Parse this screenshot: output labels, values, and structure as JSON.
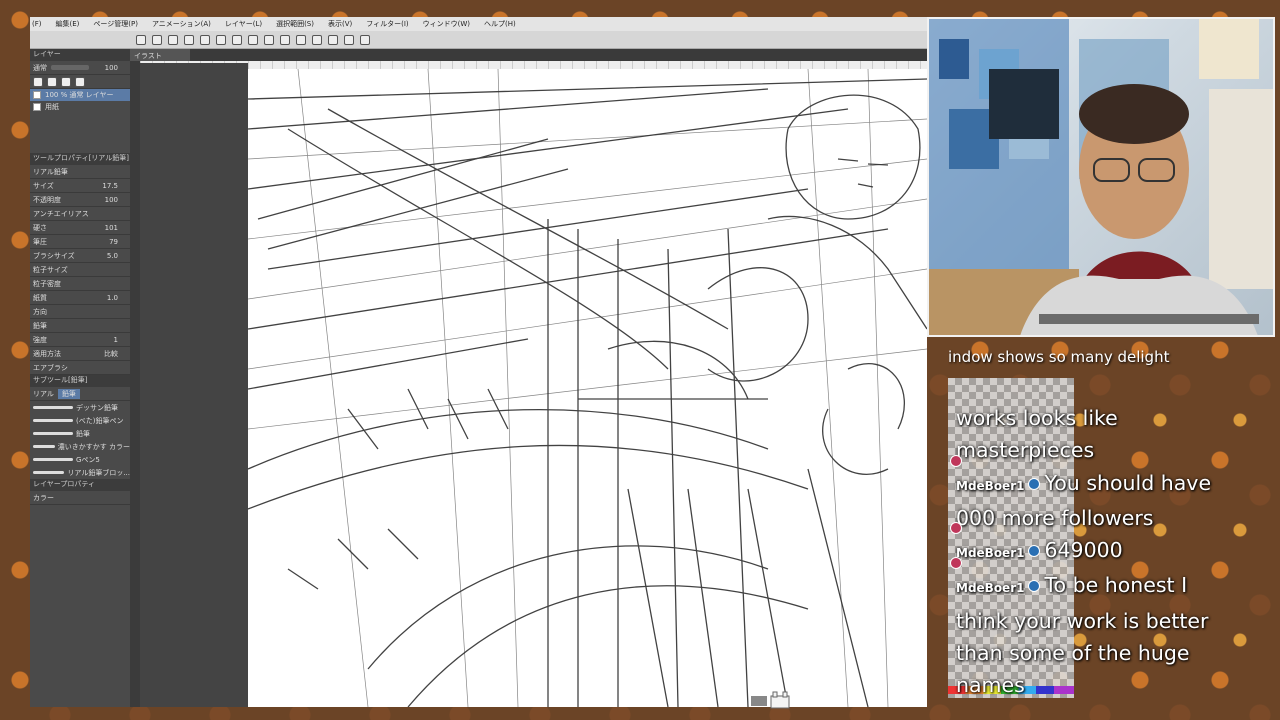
{
  "app": {
    "menu": [
      "(F)",
      "編集(E)",
      "ページ管理(P)",
      "アニメーション(A)",
      "レイヤー(L)",
      "選択範囲(S)",
      "表示(V)",
      "フィルター(I)",
      "ウィンドウ(W)",
      "ヘルプ(H)"
    ],
    "doc_tab": "イラスト"
  },
  "left_panel": {
    "layer_panel_title": "レイヤー",
    "blend_mode": "通常",
    "opacity_value": "100",
    "layers": [
      {
        "label": "100 % 通常 レイヤー",
        "selected": true
      },
      {
        "label": "用紙",
        "selected": false
      }
    ],
    "tool_property_title": "ツールプロパティ[リアル鉛筆]",
    "tool_name": "リアル鉛筆",
    "properties": [
      {
        "label": "サイズ",
        "value": "17.5"
      },
      {
        "label": "不透明度",
        "value": "100"
      },
      {
        "label": "アンチエイリアス",
        "value": ""
      },
      {
        "label": "硬さ",
        "value": "101"
      },
      {
        "label": "筆圧",
        "value": "79"
      },
      {
        "label": "ブラシサイズ",
        "value": "5.0"
      },
      {
        "label": "粒子サイズ",
        "value": ""
      },
      {
        "label": "粒子密度",
        "value": ""
      },
      {
        "label": "紙質",
        "value": "1.0"
      },
      {
        "label": "方向",
        "value": ""
      },
      {
        "label": "鉛筆",
        "value": ""
      },
      {
        "label": "強度",
        "value": "1"
      },
      {
        "label": "適用方法",
        "value": "比較"
      },
      {
        "label": "エアブラシ",
        "value": ""
      }
    ],
    "sub_tool_title": "サブツール[鉛筆]",
    "sub_tool_tabs": [
      "リアル",
      "鉛筆"
    ],
    "brushes": [
      "デッサン鉛筆",
      "(べた)鉛筆ペン",
      "鉛筆",
      "濃いきかすかす カラー",
      "Gペン5",
      "リアル鉛筆ブロッ..."
    ],
    "color_label": "カラー",
    "layer_prop_title": "レイヤープロパティ"
  },
  "chat": {
    "partial_line": "indow shows so many delight",
    "messages": [
      {
        "user": "",
        "text": "works looks like"
      },
      {
        "user": "",
        "text": "masterpieces"
      },
      {
        "user": "MdeBoer1",
        "text": "You should have"
      },
      {
        "user": "",
        "text": "000 more followers"
      },
      {
        "user": "MdeBoer1",
        "text": "649000"
      },
      {
        "user": "MdeBoer1",
        "text": "To be honest I"
      },
      {
        "user": "",
        "text": "think your work is better"
      },
      {
        "user": "",
        "text": "than some of the huge"
      },
      {
        "user": "",
        "text": "names"
      }
    ]
  },
  "colors": {
    "menubar_bg": "#e4e4e4",
    "panel_bg": "#4a4a4a",
    "selected_layer": "#5b7ba6",
    "chat_text": "#ffffff"
  }
}
